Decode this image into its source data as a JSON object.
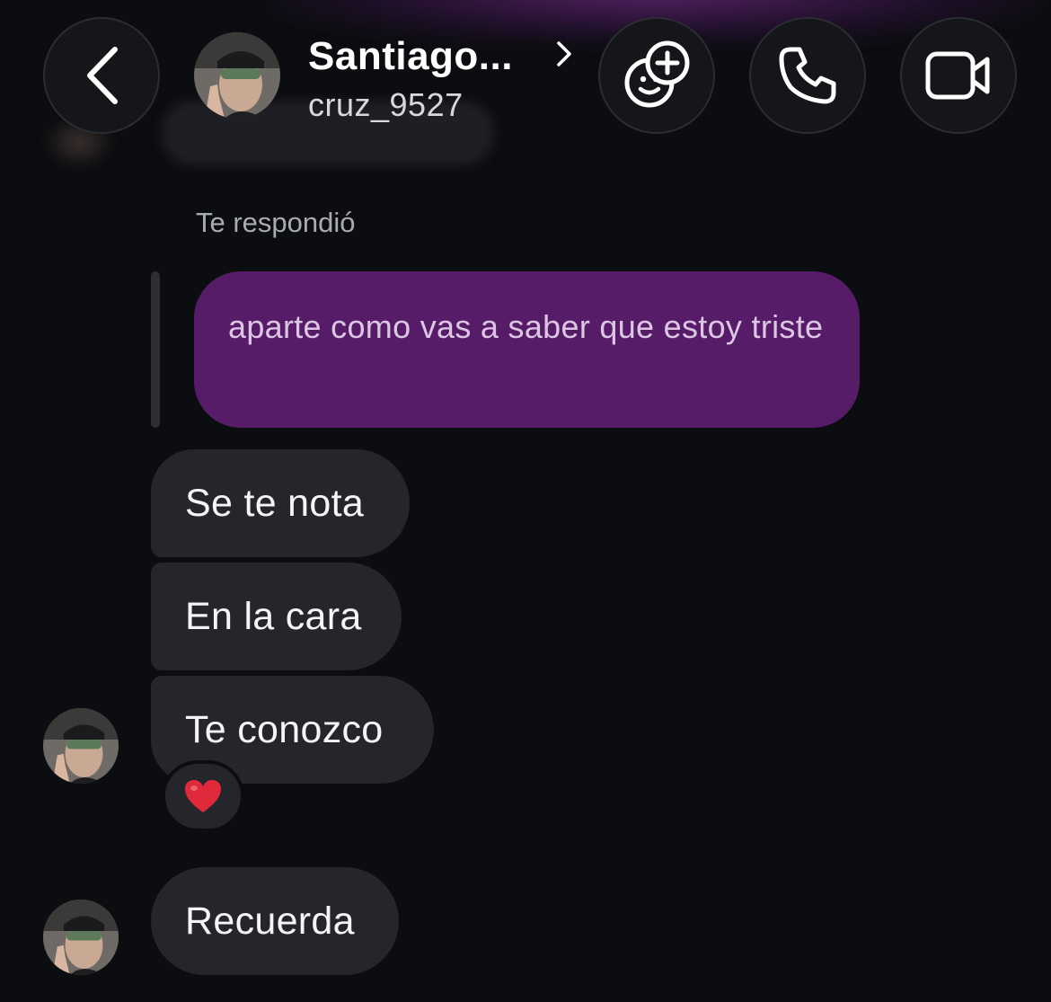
{
  "header": {
    "name": "Santiago...",
    "username": "cruz_9527",
    "back_icon": "chevron-left-icon",
    "effects_icon": "add-emoji-icon",
    "call_icon": "phone-icon",
    "video_icon": "video-camera-icon"
  },
  "conversation": {
    "reply_label": "Te respondió",
    "replied_message": "aparte como vas a saber que estoy triste",
    "messages": [
      {
        "text": "Se te nota"
      },
      {
        "text": "En la cara"
      },
      {
        "text": "Te conozco",
        "reaction": "❤️"
      },
      {
        "text": "Recuerda"
      }
    ]
  },
  "colors": {
    "background": "#0c0d10",
    "outgoing_bubble": "#561c68",
    "incoming_bubble": "#24262b",
    "reaction_heart": "#e0293a"
  }
}
